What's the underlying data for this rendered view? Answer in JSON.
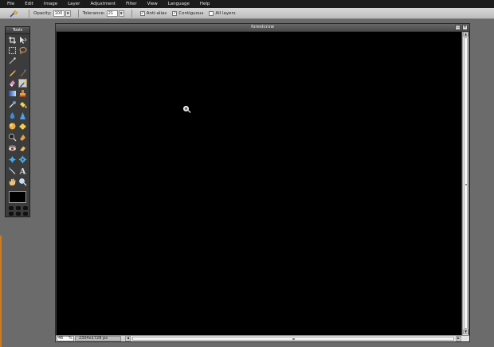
{
  "menubar": {
    "items": [
      {
        "label": "File"
      },
      {
        "label": "Edit"
      },
      {
        "label": "Image"
      },
      {
        "label": "Layer"
      },
      {
        "label": "Adjustment"
      },
      {
        "label": "Filter"
      },
      {
        "label": "View"
      },
      {
        "label": "Language"
      },
      {
        "label": "Help"
      }
    ]
  },
  "options": {
    "tool_icon": "magic-wand-icon",
    "opacity_label": "Opacity:",
    "opacity_value": "100",
    "tolerance_label": "Tolerance:",
    "tolerance_value": "21",
    "antialias_label": "Anti-alias",
    "antialias_checked": true,
    "contiguous_label": "Contiguous",
    "contiguous_checked": true,
    "all_layers_label": "All layers",
    "all_layers_checked": false
  },
  "tools": {
    "title": "Tools",
    "selected": "magic-wand",
    "primary_color": "#000000"
  },
  "document": {
    "title": "forestcrow",
    "zoom": "46",
    "zoom_unit": "%",
    "dimensions": "2304x1728 px",
    "canvas_color": "#000000"
  },
  "colors": {
    "menubar_bg": "#1c1c1c",
    "workspace_bg": "#6b6b6b",
    "accent_orange": "#d07a20"
  }
}
